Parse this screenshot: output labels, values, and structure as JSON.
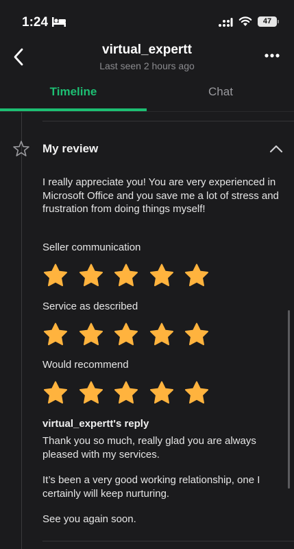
{
  "status_bar": {
    "time": "1:24",
    "battery": "47"
  },
  "header": {
    "title": "virtual_expertt",
    "subtitle": "Last seen 2 hours ago"
  },
  "tabs": [
    {
      "label": "Timeline",
      "active": true
    },
    {
      "label": "Chat",
      "active": false
    }
  ],
  "review": {
    "title": "My review",
    "text": "I really appreciate you! You are very experienced in Microsoft Office and you save me a lot of stress and frustration from doing things myself!",
    "ratings": [
      {
        "label": "Seller communication",
        "stars": 5,
        "max": 5
      },
      {
        "label": "Service as described",
        "stars": 5,
        "max": 5
      },
      {
        "label": "Would recommend",
        "stars": 5,
        "max": 5
      }
    ]
  },
  "reply": {
    "title": "virtual_expertt's reply",
    "paragraphs": [
      "Thank you so much, really glad you are always pleased with my services.",
      "It’s been a very good working relationship, one I certainly will keep nurturing.",
      "See you again soon."
    ]
  },
  "colors": {
    "accent": "#1dbf73",
    "star": "#ffb33e",
    "background": "#1b1b1d"
  },
  "icons": [
    "bed-icon",
    "cellular-signal-icon",
    "wifi-icon",
    "battery-icon",
    "back-chevron-icon",
    "more-dots-icon",
    "star-outline-icon",
    "chevron-up-icon",
    "star-icon"
  ]
}
